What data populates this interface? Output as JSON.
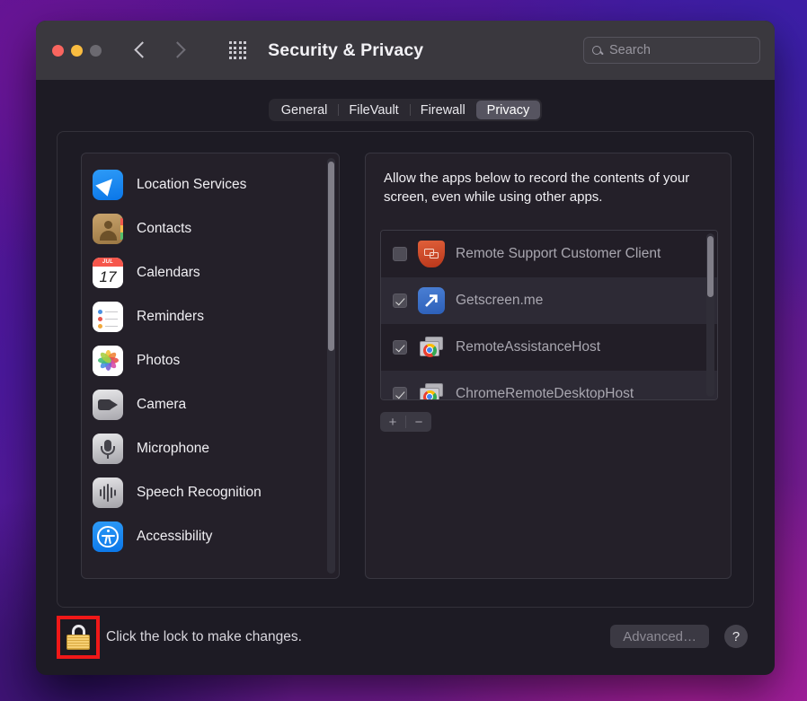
{
  "window": {
    "title": "Security & Privacy",
    "traffic_lights": [
      "close",
      "minimize",
      "zoom"
    ],
    "back_label": "Back",
    "forward_label": "Forward",
    "grid_label": "Show All",
    "search": {
      "placeholder": "Search",
      "value": ""
    }
  },
  "tabs": [
    {
      "label": "General",
      "active": false
    },
    {
      "label": "FileVault",
      "active": false
    },
    {
      "label": "Firewall",
      "active": false
    },
    {
      "label": "Privacy",
      "active": true
    }
  ],
  "sidebar": {
    "items": [
      {
        "label": "Location Services",
        "icon": "location-services-icon"
      },
      {
        "label": "Contacts",
        "icon": "contacts-icon"
      },
      {
        "label": "Calendars",
        "icon": "calendars-icon",
        "badge_month": "JUL",
        "badge_day": "17"
      },
      {
        "label": "Reminders",
        "icon": "reminders-icon"
      },
      {
        "label": "Photos",
        "icon": "photos-icon"
      },
      {
        "label": "Camera",
        "icon": "camera-icon"
      },
      {
        "label": "Microphone",
        "icon": "microphone-icon"
      },
      {
        "label": "Speech Recognition",
        "icon": "speech-recognition-icon"
      },
      {
        "label": "Accessibility",
        "icon": "accessibility-icon"
      }
    ]
  },
  "panel": {
    "description": "Allow the apps below to record the contents of your screen, even while using other apps.",
    "apps": [
      {
        "name": "Remote Support Customer Client",
        "checked": false,
        "icon": "remote-support-shield-icon"
      },
      {
        "name": "Getscreen.me",
        "checked": true,
        "icon": "getscreen-arrow-icon"
      },
      {
        "name": "RemoteAssistanceHost",
        "checked": true,
        "icon": "chrome-window-icon"
      },
      {
        "name": "ChromeRemoteDesktopHost",
        "checked": true,
        "icon": "chrome-window-icon"
      }
    ],
    "add_label": "+",
    "remove_label": "−"
  },
  "footer": {
    "lock_text": "Click the lock to make changes.",
    "lock_state": "locked",
    "advanced_label": "Advanced…",
    "advanced_enabled": false,
    "help_label": "?"
  },
  "colors": {
    "accent_blue": "#2e9bf7",
    "annotation_red": "#f01818",
    "lock_gold": "#f6cf72",
    "window_chrome": "#3a383e",
    "window_body": "#1d1b24"
  }
}
